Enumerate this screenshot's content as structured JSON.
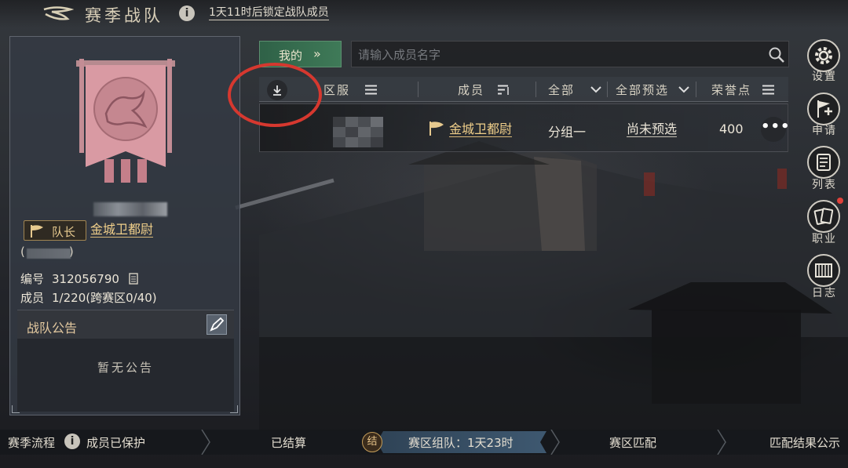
{
  "header": {
    "title": "赛季战队",
    "lock_note": "1天11时后锁定战队成员"
  },
  "team": {
    "rank_label": "队长",
    "rank_title": "金城卫都尉",
    "paren_open": "(",
    "paren_close": ")",
    "id_label": "编号",
    "id_value": "312056790",
    "member_label": "成员",
    "member_value": "1/220(跨赛区0/40)",
    "notice_title": "战队公告",
    "notice_empty": "暂无公告"
  },
  "filters": {
    "tab_mine": "我的",
    "tab_arrow": "»",
    "search_placeholder": "请输入成员名字"
  },
  "columns": {
    "server": "区服",
    "member": "成员",
    "all": "全部",
    "all_pre": "全部预选",
    "honor": "荣誉点"
  },
  "rows": [
    {
      "title": "金城卫都尉",
      "group": "分组一",
      "preselect": "尚未预选",
      "points": "400",
      "more": "•••"
    }
  ],
  "sidebar": [
    {
      "label": "设置",
      "icon": "gear-icon"
    },
    {
      "label": "申请",
      "icon": "flag-cross-icon"
    },
    {
      "label": "列表",
      "icon": "list-icon"
    },
    {
      "label": "职业",
      "icon": "cards-icon"
    },
    {
      "label": "日志",
      "icon": "log-icon"
    }
  ],
  "bottom": {
    "process_label": "赛季流程",
    "protected": "成员已保护",
    "settled": "已结算",
    "seal": "结",
    "active_stage": "赛区组队：1天23时",
    "matching": "赛区匹配",
    "result": "匹配结果公示"
  },
  "colors": {
    "accent_gold": "#f0cf8a",
    "tab_green": "#3f7a58",
    "annotation_red": "#d6382f",
    "banner_pink": "#d99aa3"
  }
}
